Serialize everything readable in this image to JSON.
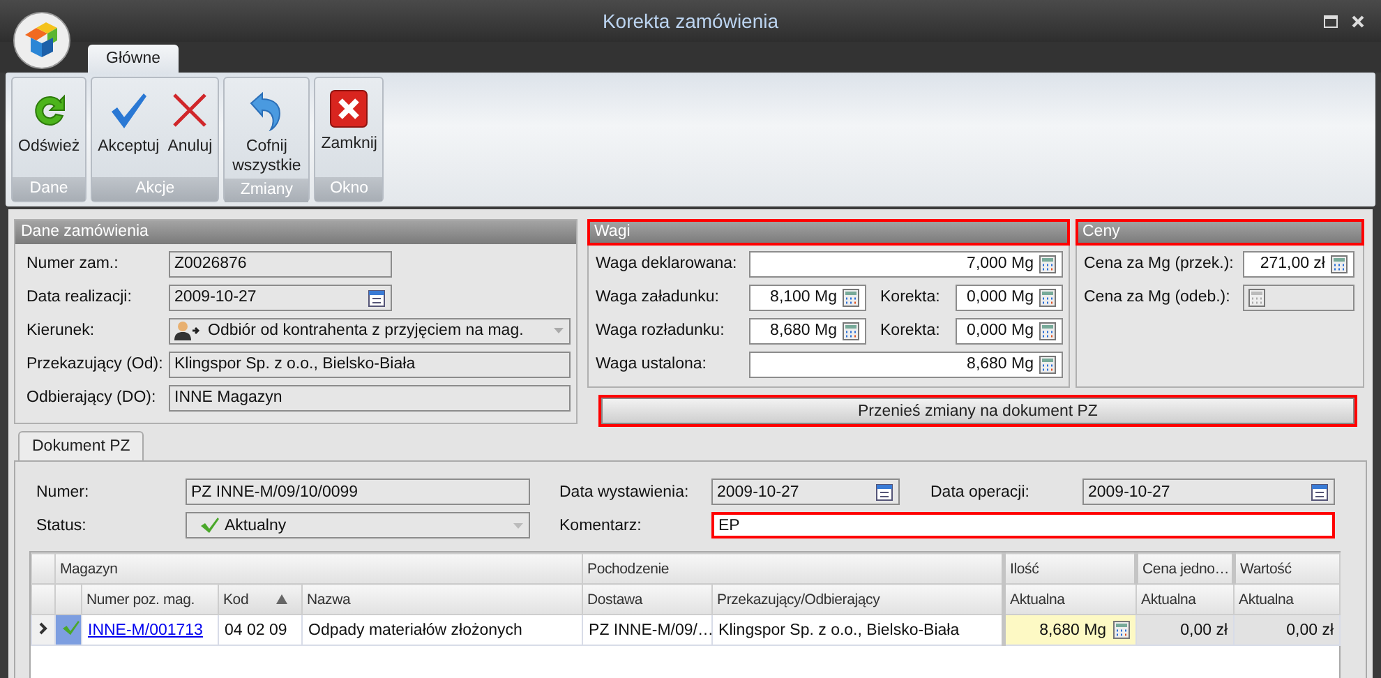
{
  "window": {
    "title": "Korekta zamówienia"
  },
  "ribbon": {
    "tabs": [
      {
        "label": "Główne",
        "selected": true
      }
    ],
    "groups": [
      {
        "label": "Dane",
        "buttons": [
          {
            "label": "Odśwież",
            "kind": "refresh"
          }
        ]
      },
      {
        "label": "Akcje",
        "buttons": [
          {
            "label": "Akceptuj",
            "kind": "accept"
          },
          {
            "label": "Anuluj",
            "kind": "cancel"
          }
        ]
      },
      {
        "label": "Zmiany",
        "buttons": [
          {
            "label": "Cofnij wszystkie",
            "kind": "undo"
          }
        ]
      },
      {
        "label": "Okno",
        "buttons": [
          {
            "label": "Zamknij",
            "kind": "close"
          }
        ]
      }
    ]
  },
  "order": {
    "title": "Dane zamówienia",
    "fields": [
      {
        "label": "Numer zam.:",
        "value": "Z0026876",
        "kind": "text",
        "disabled": true
      },
      {
        "label": "Data realizacji:",
        "value": "2009-10-27",
        "kind": "date",
        "disabled": true
      },
      {
        "label": "Kierunek:",
        "value": "Odbiór od kontrahenta z przyjęciem na mag.",
        "kind": "select",
        "disabled": true
      },
      {
        "label": "Przekazujący (Od):",
        "value": "Klingspor Sp. z o.o., Bielsko-Biała",
        "kind": "text",
        "disabled": true
      },
      {
        "label": "Odbierający (DO):",
        "value": "INNE Magazyn",
        "kind": "text",
        "disabled": true
      }
    ]
  },
  "weights": {
    "title": "Wagi",
    "highlighted": true,
    "rows": [
      {
        "label": "Waga deklarowana:",
        "value": "7,000 Mg"
      },
      {
        "label": "Waga załadunku:",
        "value": "8,100 Mg",
        "correction": {
          "label": "Korekta:",
          "value": "0,000 Mg"
        }
      },
      {
        "label": "Waga rozładunku:",
        "value": "8,680 Mg",
        "correction": {
          "label": "Korekta:",
          "value": "0,000 Mg"
        }
      },
      {
        "label": "Waga ustalona:",
        "value": "8,680 Mg"
      }
    ]
  },
  "prices": {
    "title": "Ceny",
    "highlighted": true,
    "fields": [
      {
        "label": "Cena za Mg (przek.):",
        "value": "271,00 zł",
        "disabled": false
      },
      {
        "label": "Cena za Mg (odeb.):",
        "disabled": true
      }
    ]
  },
  "transfer_button": {
    "label": "Przenieś zmiany na dokument PZ",
    "highlighted": true
  },
  "document": {
    "tabs": [
      {
        "label": "Dokument PZ",
        "selected": true
      }
    ],
    "fields": [
      {
        "label": "Numer:",
        "value": "PZ INNE-M/09/10/0099",
        "kind": "text",
        "disabled": true,
        "highlighted": false
      },
      {
        "label": "Data wystawienia:",
        "value": "2009-10-27",
        "kind": "date",
        "disabled": true,
        "highlighted": false
      },
      {
        "label": "Data operacji:",
        "value": "2009-10-27",
        "kind": "date",
        "disabled": true,
        "highlighted": false
      },
      {
        "label": "Status:",
        "value": "Aktualny",
        "kind": "select",
        "disabled": true,
        "highlighted": false
      },
      {
        "label": "Komentarz:",
        "value": "EP",
        "kind": "text",
        "disabled": false,
        "highlighted": true
      }
    ],
    "table": {
      "group_headers": [
        "Magazyn",
        "Pochodzenie",
        "Ilość",
        "Cena jedno…",
        "Wartość"
      ],
      "columns": [
        {
          "label": "Numer poz. mag.",
          "sorted": false
        },
        {
          "label": "Kod",
          "sorted": true
        },
        {
          "label": "Nazwa",
          "sorted": false
        },
        {
          "label": "Dostawa",
          "sorted": false
        },
        {
          "label": "Przekazujący/Odbierający",
          "sorted": false
        },
        {
          "label": "Aktualna",
          "sorted": false
        },
        {
          "label": "Aktualna",
          "sorted": false
        },
        {
          "label": "Aktualna",
          "sorted": false
        }
      ],
      "rows": [
        {
          "selected": true,
          "checked": true,
          "cells": [
            "INNE-M/001713",
            "04 02 09",
            "Odpady materiałów złożonych",
            "PZ INNE-M/09/…",
            "Klingspor Sp. z o.o., Bielsko-Biała",
            "8,680 Mg",
            "0,00 zł",
            "0,00 zł"
          ]
        }
      ]
    }
  }
}
